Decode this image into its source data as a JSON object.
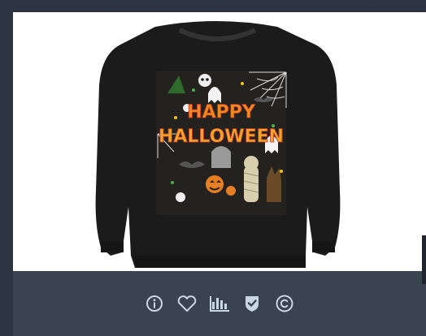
{
  "product": {
    "print_line1": "HAPPY",
    "print_line2": "HALLOWEEN"
  },
  "toolbar": {
    "buttons": [
      {
        "name": "info",
        "icon": "info-icon"
      },
      {
        "name": "favorite",
        "icon": "heart-icon"
      },
      {
        "name": "stats",
        "icon": "bar-chart-icon"
      },
      {
        "name": "verified",
        "icon": "shield-check-icon"
      },
      {
        "name": "copyright",
        "icon": "copyright-icon"
      }
    ]
  },
  "colors": {
    "page_bg": "#2b3440",
    "toolbar_bg": "#3a4350",
    "icon": "#c9d6e3",
    "sweater": "#1b1b1b",
    "print_orange": "#f08a1c"
  }
}
